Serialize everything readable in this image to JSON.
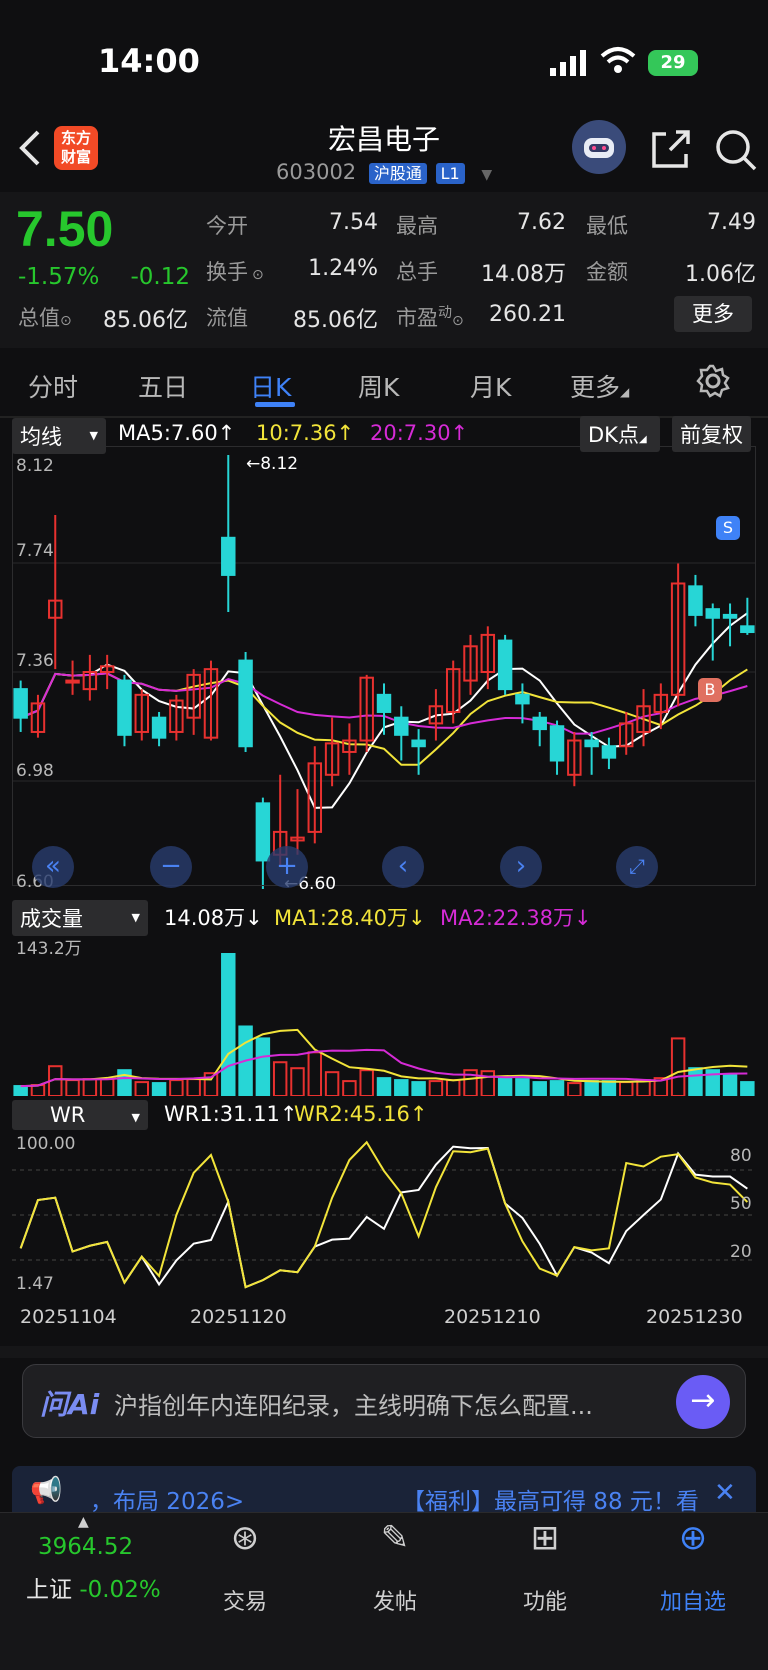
{
  "status": {
    "time": "14:00",
    "battery": "29"
  },
  "header": {
    "logo_text": "东方财富",
    "title": "宏昌电子",
    "code": "603002",
    "tag1": "沪股通",
    "tag2": "L1"
  },
  "quote": {
    "price": "7.50",
    "change_pct": "-1.57%",
    "change": "-0.12",
    "open_label": "今开",
    "open": "7.54",
    "high_label": "最高",
    "high": "7.62",
    "low_label": "最低",
    "low": "7.49",
    "turnover_label": "换手",
    "turnover": "1.24%",
    "volume_label": "总手",
    "volume": "14.08万",
    "amount_label": "金额",
    "amount": "1.06亿",
    "mcap_label": "总值",
    "mcap": "85.06亿",
    "float_label": "流值",
    "float": "85.06亿",
    "pe_label": "市盈",
    "pe_sup": "动",
    "pe": "260.21",
    "more_label": "更多"
  },
  "tabs": [
    "分时",
    "五日",
    "日K",
    "周K",
    "月K",
    "更多"
  ],
  "ma_bar": {
    "dropdown": "均线",
    "ma5": "MA5:7.60↑",
    "ma10": "10:7.36↑",
    "ma20": "20:7.30↑",
    "dk": "DK点",
    "adjust": "前复权"
  },
  "price_axis": {
    "top": "8.12",
    "l2": "7.74",
    "l3": "7.36",
    "l4": "6.98",
    "bottom": "6.60",
    "max_mark": "←8.12",
    "min_mark": "←6.60"
  },
  "vol_bar": {
    "dropdown": "成交量",
    "v": "14.08万↓",
    "ma1": "MA1:28.40万↓",
    "ma2": "MA2:22.38万↓",
    "top": "143.2万"
  },
  "wr_bar": {
    "dropdown": "WR",
    "wr1": "WR1:31.11↑",
    "wr2": "WR2:45.16↑",
    "top": "100.00",
    "bottom": "1.47",
    "r80": "80",
    "r50": "50",
    "r20": "20"
  },
  "dates": [
    "20251104",
    "20251120",
    "20251210",
    "20251230"
  ],
  "ai": {
    "logo": "问Ai",
    "text": "沪指创年内连阳纪录，主线明确下怎么配置..."
  },
  "ticker": {
    "left": "，布局 2026>",
    "right": "【福利】最高可得 88 元！看"
  },
  "nav": {
    "index_value": "3964.52",
    "index_name": "上证",
    "index_change": "-0.02%",
    "items": [
      "交易",
      "发帖",
      "功能",
      "加自选"
    ]
  },
  "colors": {
    "up": "#e8312f",
    "down": "#27d6d6",
    "ma5": "#ffffff",
    "ma10": "#f2e43a",
    "ma20": "#d62bd6",
    "accent": "#3f82f7"
  },
  "chart_data": {
    "type": "candlestick",
    "ylim": [
      6.6,
      8.12
    ],
    "candles": [
      {
        "o": 7.3,
        "c": 7.2,
        "h": 7.33,
        "l": 7.15
      },
      {
        "o": 7.15,
        "c": 7.25,
        "h": 7.28,
        "l": 7.13
      },
      {
        "o": 7.55,
        "c": 7.61,
        "h": 7.91,
        "l": 7.37
      },
      {
        "o": 7.33,
        "c": 7.33,
        "h": 7.4,
        "l": 7.28
      },
      {
        "o": 7.3,
        "c": 7.36,
        "h": 7.42,
        "l": 7.26
      },
      {
        "o": 7.36,
        "c": 7.38,
        "h": 7.42,
        "l": 7.3
      },
      {
        "o": 7.33,
        "c": 7.14,
        "h": 7.35,
        "l": 7.1
      },
      {
        "o": 7.15,
        "c": 7.28,
        "h": 7.3,
        "l": 7.12
      },
      {
        "o": 7.2,
        "c": 7.13,
        "h": 7.22,
        "l": 7.1
      },
      {
        "o": 7.15,
        "c": 7.26,
        "h": 7.28,
        "l": 7.12
      },
      {
        "o": 7.2,
        "c": 7.35,
        "h": 7.37,
        "l": 7.14
      },
      {
        "o": 7.13,
        "c": 7.37,
        "h": 7.4,
        "l": 7.12
      },
      {
        "o": 7.83,
        "c": 7.7,
        "h": 8.12,
        "l": 7.57
      },
      {
        "o": 7.4,
        "c": 7.1,
        "h": 7.43,
        "l": 7.08
      },
      {
        "o": 6.9,
        "c": 6.7,
        "h": 6.92,
        "l": 6.6
      },
      {
        "o": 6.72,
        "c": 6.8,
        "h": 7.0,
        "l": 6.68
      },
      {
        "o": 6.77,
        "c": 6.78,
        "h": 6.95,
        "l": 6.72
      },
      {
        "o": 6.8,
        "c": 7.04,
        "h": 7.1,
        "l": 6.76
      },
      {
        "o": 7.0,
        "c": 7.11,
        "h": 7.2,
        "l": 6.96
      },
      {
        "o": 7.08,
        "c": 7.12,
        "h": 7.18,
        "l": 7.0
      },
      {
        "o": 7.12,
        "c": 7.34,
        "h": 7.35,
        "l": 7.08
      },
      {
        "o": 7.28,
        "c": 7.22,
        "h": 7.32,
        "l": 7.14
      },
      {
        "o": 7.2,
        "c": 7.14,
        "h": 7.24,
        "l": 7.05
      },
      {
        "o": 7.12,
        "c": 7.1,
        "h": 7.16,
        "l": 7.0
      },
      {
        "o": 7.18,
        "c": 7.24,
        "h": 7.3,
        "l": 7.12
      },
      {
        "o": 7.22,
        "c": 7.37,
        "h": 7.4,
        "l": 7.18
      },
      {
        "o": 7.33,
        "c": 7.45,
        "h": 7.49,
        "l": 7.28
      },
      {
        "o": 7.36,
        "c": 7.49,
        "h": 7.52,
        "l": 7.3
      },
      {
        "o": 7.47,
        "c": 7.3,
        "h": 7.49,
        "l": 7.28
      },
      {
        "o": 7.28,
        "c": 7.25,
        "h": 7.32,
        "l": 7.18
      },
      {
        "o": 7.2,
        "c": 7.16,
        "h": 7.22,
        "l": 7.1
      },
      {
        "o": 7.17,
        "c": 7.05,
        "h": 7.19,
        "l": 7.0
      },
      {
        "o": 7.0,
        "c": 7.12,
        "h": 7.15,
        "l": 6.96
      },
      {
        "o": 7.12,
        "c": 7.1,
        "h": 7.15,
        "l": 7.0
      },
      {
        "o": 7.1,
        "c": 7.06,
        "h": 7.13,
        "l": 7.02
      },
      {
        "o": 7.1,
        "c": 7.18,
        "h": 7.22,
        "l": 7.07
      },
      {
        "o": 7.15,
        "c": 7.24,
        "h": 7.3,
        "l": 7.1
      },
      {
        "o": 7.22,
        "c": 7.28,
        "h": 7.32,
        "l": 7.16
      },
      {
        "o": 7.28,
        "c": 7.67,
        "h": 7.74,
        "l": 7.24
      },
      {
        "o": 7.66,
        "c": 7.56,
        "h": 7.7,
        "l": 7.52
      },
      {
        "o": 7.58,
        "c": 7.55,
        "h": 7.6,
        "l": 7.4
      },
      {
        "o": 7.56,
        "c": 7.55,
        "h": 7.6,
        "l": 7.45
      },
      {
        "o": 7.52,
        "c": 7.5,
        "h": 7.62,
        "l": 7.49
      }
    ],
    "volume": [
      10,
      11,
      30,
      16,
      17,
      17,
      26,
      14,
      13,
      16,
      17,
      23,
      143,
      70,
      58,
      34,
      28,
      44,
      24,
      15,
      26,
      18,
      16,
      14,
      15,
      16,
      26,
      25,
      18,
      17,
      14,
      15,
      13,
      15,
      15,
      14,
      16,
      18,
      58,
      28,
      26,
      22,
      14
    ]
  }
}
